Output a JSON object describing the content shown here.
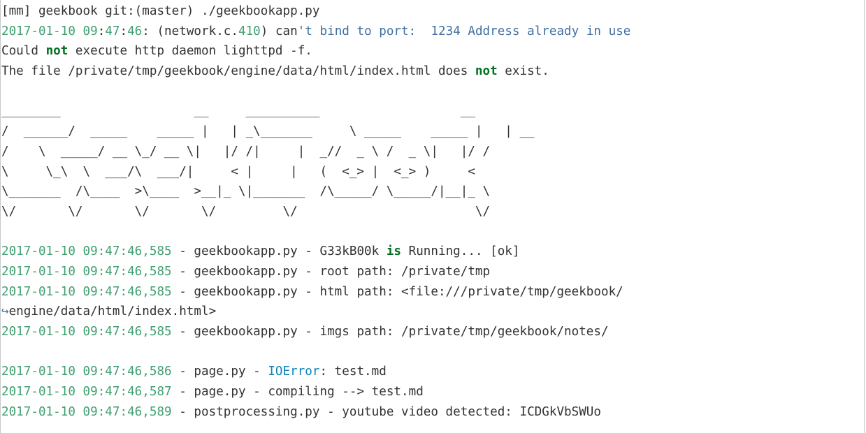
{
  "colors": {
    "text": "#333333",
    "number": "#40a070",
    "string": "#4070a0",
    "keyword": "#007020",
    "exception": "#0e84b5"
  },
  "icons": {
    "line_continuation": "hooked-arrow-icon"
  },
  "command": {
    "prompt": "[mm] geekbook git:(master) ./geekbookapp.py"
  },
  "startup_errors": {
    "bind_date": "2017-01-10",
    "bind_time_h": "09",
    "bind_time_sep1": ":",
    "bind_time_m": "47",
    "bind_time_sep2": ":",
    "bind_time_s": "46",
    "bind_pre": ": (network.c.",
    "bind_code": "410",
    "bind_mid": ") can",
    "bind_str": "'t bind to port:  1234 Address already in use",
    "daemon_pre": "Could ",
    "daemon_kw": "not",
    "daemon_post": " execute http daemon lighttpd -f.",
    "file_pre": "The file /private/tmp/geekbook/engine/data/html/index.html does ",
    "file_kw": "not",
    "file_post": " exist."
  },
  "banner": {
    "lines": [
      "________                  __     __________                   __",
      "/  ______/  _____    _____ |   | _\\_______     \\ _____    _____ |   | __",
      "/    \\  _____/ __ \\_/ __ \\|   |/ /|     |  _//  _ \\ /  _ \\|   |/ /",
      "\\     \\_\\  \\  ___/\\  ___/|     < |     |   (  <_> |  <_> )     <",
      "\\_______  /\\____  >\\____  >__|_ \\|_______  /\\_____/ \\_____/|__|_ \\",
      "\\/       \\/       \\/       \\/         \\/                        \\/"
    ]
  },
  "log": {
    "running": {
      "date": "2017-01-10",
      "time": "09:47:46,585",
      "pre": " - geekbookapp.py - G33kB00k ",
      "kw": "is",
      "post": " Running... [ok]"
    },
    "root": {
      "date": "2017-01-10",
      "time": "09:47:46,585",
      "text": " - geekbookapp.py - root path: /private/tmp"
    },
    "html": {
      "date": "2017-01-10",
      "time": "09:47:46,585",
      "text": " - geekbookapp.py - html path: <file:///private/tmp/geekbook/",
      "continuation_glyph": "↪",
      "continuation_text": "engine/data/html/index.html>"
    },
    "imgs": {
      "date": "2017-01-10",
      "time": "09:47:46,585",
      "text": " - geekbookapp.py - imgs path: /private/tmp/geekbook/notes/"
    },
    "ioerror": {
      "date": "2017-01-10",
      "time": "09:47:46,586",
      "pre": " - page.py - ",
      "exc": "IOError",
      "post": ": test.md"
    },
    "compiling": {
      "date": "2017-01-10",
      "time": "09:47:46,587",
      "text": " - page.py - compiling --> test.md"
    },
    "youtube": {
      "date": "2017-01-10",
      "time": "09:47:46,589",
      "text": " - postprocessing.py - youtube video detected: ICDGkVbSWUo"
    }
  }
}
